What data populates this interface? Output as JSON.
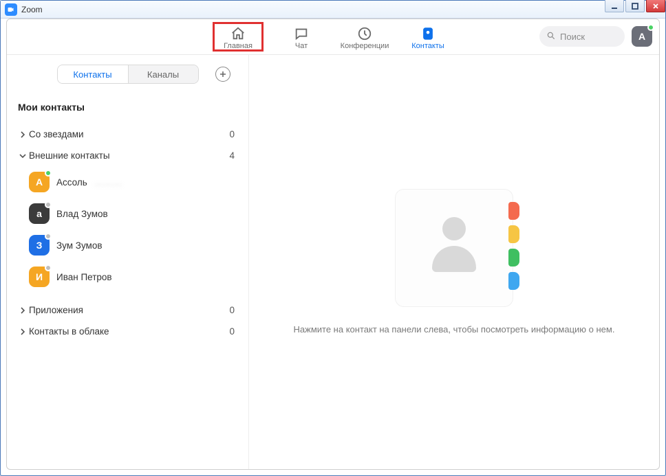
{
  "window": {
    "title": "Zoom"
  },
  "nav": {
    "home": "Главная",
    "chat": "Чат",
    "meetings": "Конференции",
    "contacts": "Контакты"
  },
  "search": {
    "placeholder": "Поиск"
  },
  "user": {
    "initial": "A"
  },
  "sidebar": {
    "seg": {
      "contacts": "Контакты",
      "channels": "Каналы"
    },
    "section_title": "Мои контакты",
    "groups": {
      "starred": {
        "name": "Со звездами",
        "count": "0",
        "expanded": false
      },
      "external": {
        "name": "Внешние контакты",
        "count": "4",
        "expanded": true
      },
      "apps": {
        "name": "Приложения",
        "count": "0",
        "expanded": false
      },
      "cloud": {
        "name": "Контакты в облаке",
        "count": "0",
        "expanded": false
      }
    },
    "external_contacts": [
      {
        "initial": "А",
        "name": "Ассоль",
        "surname_blurred": "………",
        "color": "#f5a623",
        "status": "online",
        "initial_lower": false
      },
      {
        "initial": "а",
        "name": "Влад Зумов",
        "color": "#3b3b3b",
        "status": "offline",
        "initial_lower": true
      },
      {
        "initial": "З",
        "name": "Зум Зумов",
        "color": "#1f6fe5",
        "status": "offline",
        "initial_lower": false
      },
      {
        "initial": "И",
        "name": "Иван Петров",
        "color": "#f5a623",
        "status": "offline",
        "initial_lower": false
      }
    ]
  },
  "main": {
    "hint": "Нажмите на контакт на панели слева, чтобы посмотреть информацию о нем.",
    "tab_colors": [
      "#f46a4e",
      "#f6c544",
      "#3fbf61",
      "#3fa7f0"
    ]
  }
}
